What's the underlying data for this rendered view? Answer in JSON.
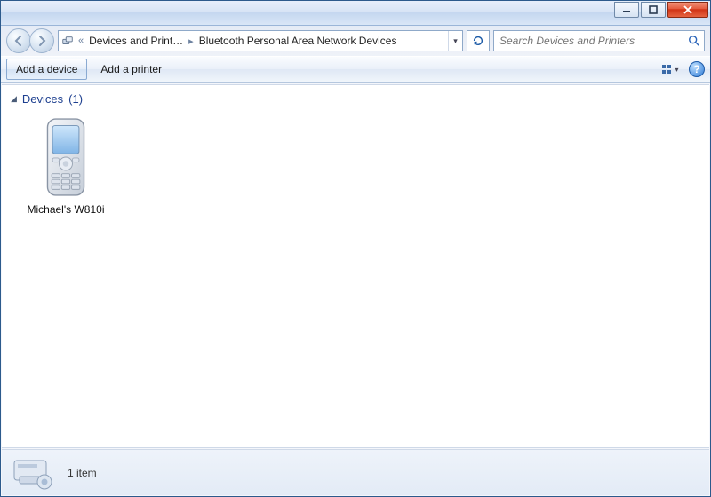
{
  "titlebar": {
    "minimize_tip": "Minimize",
    "maximize_tip": "Maximize",
    "close_tip": "Close"
  },
  "breadcrumb": {
    "segment1": "Devices and Print…",
    "segment2": "Bluetooth Personal Area Network Devices"
  },
  "search": {
    "placeholder": "Search Devices and Printers"
  },
  "toolbar": {
    "add_device": "Add a device",
    "add_printer": "Add a printer"
  },
  "group": {
    "label": "Devices",
    "count": "(1)"
  },
  "devices": [
    {
      "name": "Michael's W810i"
    }
  ],
  "details": {
    "summary": "1 item"
  }
}
